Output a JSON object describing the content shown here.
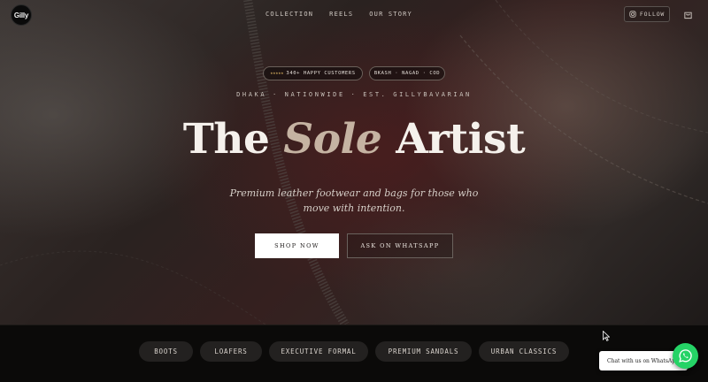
{
  "header": {
    "logo_text": "Gilly",
    "nav": [
      "COLLECTION",
      "REELS",
      "OUR STORY"
    ],
    "follow_label": "FOLLOW"
  },
  "hero": {
    "badges": {
      "rating_stars": "★★★★★",
      "customers": "340+ HAPPY CUSTOMERS",
      "payments": "BKASH · NAGAD · COD"
    },
    "tagline": "DHAKA · NATIONWIDE · EST. GILLYBAVARIAN",
    "title_part1": "The",
    "title_accent": "Sole",
    "title_part2": "Artist",
    "subtitle": "Premium leather footwear and bags for those who move with intention.",
    "cta_primary": "SHOP NOW",
    "cta_secondary": "ASK ON WHATSAPP"
  },
  "categories": [
    "BOOTS",
    "LOAFERS",
    "EXECUTIVE FORMAL",
    "PREMIUM SANDALS",
    "URBAN CLASSICS"
  ],
  "whatsapp": {
    "chat_label": "Chat with us on WhatsApp"
  },
  "colors": {
    "accent_gold": "#c9a45a",
    "title_accent": "#c5b3a2",
    "whatsapp_green": "#25d366"
  }
}
